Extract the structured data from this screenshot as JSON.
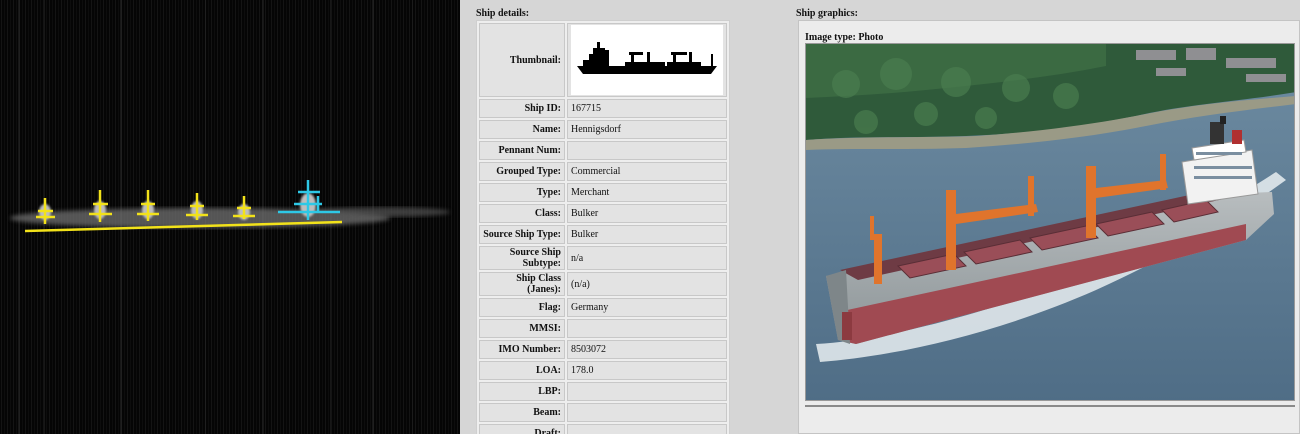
{
  "details": {
    "title": "Ship details:",
    "thumbnail_label": "Thumbnail:",
    "rows": [
      {
        "label": "Ship ID:",
        "value": "167715"
      },
      {
        "label": "Name:",
        "value": "Hennigsdorf"
      },
      {
        "label": "Pennant Num:",
        "value": ""
      },
      {
        "label": "Grouped Type:",
        "value": "Commercial"
      },
      {
        "label": "Type:",
        "value": "Merchant"
      },
      {
        "label": "Class:",
        "value": "Bulker"
      },
      {
        "label": "Source Ship Type:",
        "value": "Bulker"
      },
      {
        "label": "Source Ship Subtype:",
        "value": "n/a"
      },
      {
        "label": "Ship Class (Janes):",
        "value": "(n/a)"
      },
      {
        "label": "Flag:",
        "value": "Germany"
      },
      {
        "label": "MMSI:",
        "value": ""
      },
      {
        "label": "IMO Number:",
        "value": "8503072"
      },
      {
        "label": "LOA:",
        "value": "178.0"
      },
      {
        "label": "LBP:",
        "value": ""
      },
      {
        "label": "Beam:",
        "value": ""
      },
      {
        "label": "Draft:",
        "value": ""
      }
    ]
  },
  "graphics": {
    "title": "Ship graphics:",
    "image_type": "Image type: Photo"
  },
  "colors": {
    "annotation_yellow": "#f2e21a",
    "annotation_cyan": "#2ec8e6",
    "hull_red": "#a04a52",
    "crane_orange": "#e0742c",
    "water": "#5f7f98"
  }
}
